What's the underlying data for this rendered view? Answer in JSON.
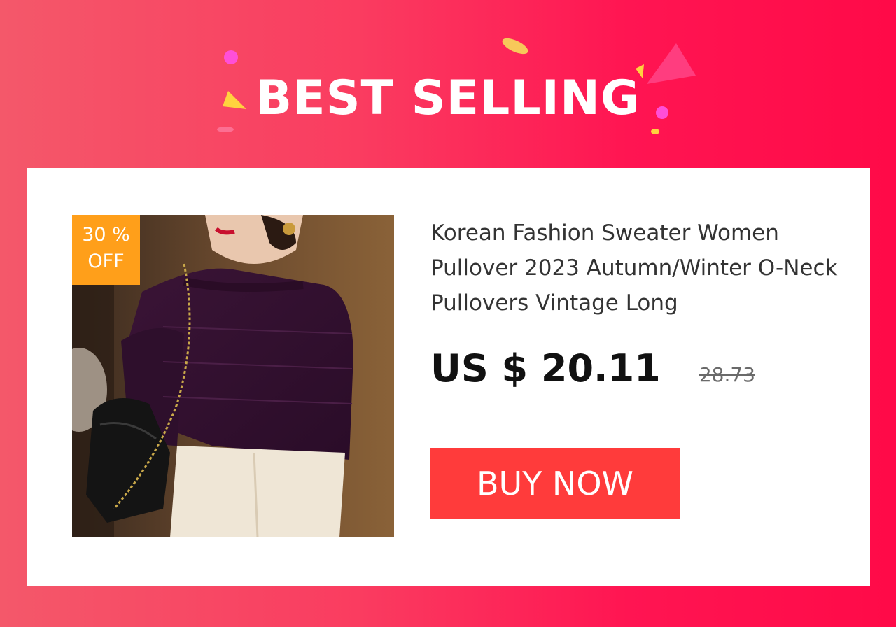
{
  "banner": {
    "title": "BEST SELLING"
  },
  "product": {
    "discount_badge": "30 %\nOFF",
    "title": "Korean Fashion Sweater Women Pullover 2023 Autumn/Winter O-Neck Pullovers Vintage Long",
    "price_current": "US $ 20.11",
    "price_original": "28.73",
    "image_alt": "woman-in-purple-sweater-photo"
  },
  "actions": {
    "buy_label": "BUY NOW"
  },
  "colors": {
    "background_left": "#f4586a",
    "background_right": "#ff0a48",
    "card": "#ffffff",
    "badge": "#ff9f1a",
    "buy_button": "#ff3b3b",
    "price": "#111111"
  }
}
